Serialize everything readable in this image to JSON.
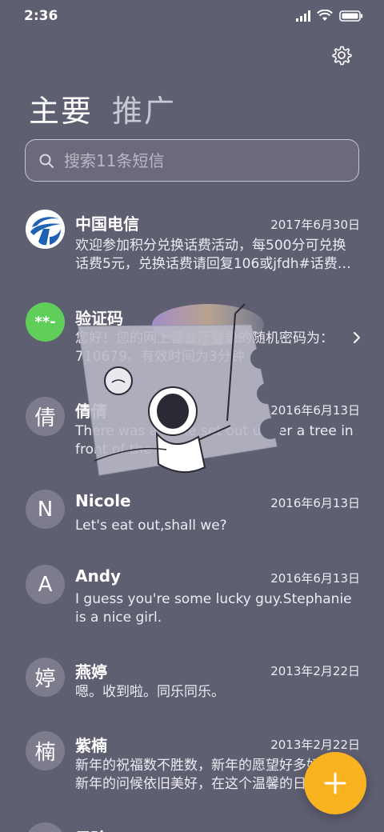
{
  "status_bar": {
    "time": "2:36",
    "icons": [
      "signal-icon",
      "wifi-icon",
      "battery-icon"
    ]
  },
  "header": {
    "settings_icon": "gear-icon",
    "tabs": [
      {
        "label": "主要",
        "active": true
      },
      {
        "label": "推广",
        "active": false
      }
    ]
  },
  "search": {
    "placeholder": "搜索11条短信"
  },
  "conversations": [
    {
      "name": "中国电信",
      "date": "2017年6月30日",
      "preview": "欢迎参加积分兑换话费活动，每500分可兑换话费5元，兑换话费请回复106或jfdh#话费…",
      "avatar": "logo"
    },
    {
      "name": "验证码",
      "date": "",
      "preview": "您好！您的网上营业厅登录的随机密码为：710679。有效时间为3分钟",
      "avatar": "**-",
      "avatar_color": "#5fcf5a"
    },
    {
      "name": "倩倩",
      "date": "2016年6月13日",
      "preview": "There was a table set out under a tree in front of the hous",
      "avatar": "倩"
    },
    {
      "name": "Nicole",
      "date": "2016年6月13日",
      "preview": "Let's eat out,shall we?",
      "avatar": "N"
    },
    {
      "name": "Andy",
      "date": "2016年6月13日",
      "preview": "I guess you're some lucky guy.Stephanie is a nice girl.",
      "avatar": "A"
    },
    {
      "name": "燕婷",
      "date": "2013年2月22日",
      "preview": "嗯。收到啦。同乐同乐。",
      "avatar": "婷"
    },
    {
      "name": "紫楠",
      "date": "2013年2月22日",
      "preview": "新年的祝福数不胜数，新年的愿望好多好多，新年的问候依旧美好，在这个温馨的日子",
      "avatar": "楠"
    },
    {
      "name": "子玲",
      "date": "",
      "preview": "",
      "avatar": ""
    }
  ],
  "fab": {
    "icon": "plus-icon"
  },
  "colors": {
    "background": "#5f5f72",
    "avatar_bg": "#7c7c8d",
    "fab": "#f9b321",
    "telecom_blue": "#1f62b4",
    "verify_green": "#5fcf5a"
  }
}
